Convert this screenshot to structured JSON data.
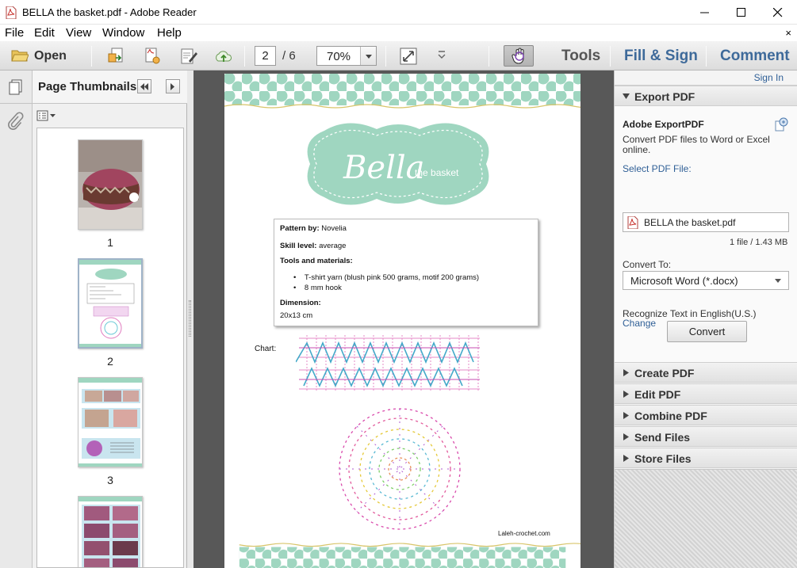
{
  "window": {
    "title": "BELLA the basket.pdf - Adobe Reader",
    "minimize_icon": "minimize-icon",
    "maximize_icon": "maximize-icon",
    "close_icon": "close-icon"
  },
  "menu": {
    "items": [
      "File",
      "Edit",
      "View",
      "Window",
      "Help"
    ],
    "close_doc": "×"
  },
  "toolbar": {
    "open_label": "Open",
    "page_current": "2",
    "page_total": "/ 6",
    "zoom": "70%",
    "tools_label": "Tools",
    "fill_sign_label": "Fill & Sign",
    "comment_label": "Comment"
  },
  "thumbnails": {
    "title": "Page Thumbnails",
    "pages": [
      "1",
      "2",
      "3"
    ]
  },
  "document": {
    "title_script": "Bella",
    "title_sub": "the basket",
    "pattern_by_label": "Pattern by:",
    "pattern_by_value": "Novelia",
    "skill_label": "Skill level:",
    "skill_value": "average",
    "tools_label": "Tools and materials:",
    "materials": [
      "T-shirt yarn (blush pink 500 grams, motif 200 grams)",
      "8 mm hook"
    ],
    "dimension_label": "Dimension:",
    "dimension_value": "20x13 cm",
    "chart_label": "Chart:",
    "site": "Laleh-crochet.com"
  },
  "right_pane": {
    "sign_in": "Sign In",
    "export_header": "Export PDF",
    "export_title": "Adobe ExportPDF",
    "export_desc_1": "Convert PDF files to Word or Excel",
    "export_desc_2": "online.",
    "select_file_label": "Select PDF File:",
    "file_name": "BELLA the basket.pdf",
    "file_info": "1 file / 1.43 MB",
    "convert_to_label": "Convert To:",
    "convert_to_value": "Microsoft Word (*.docx)",
    "recognize_text": "Recognize Text in English(U.S.)",
    "change_link": "Change",
    "convert_button": "Convert",
    "sections": [
      "Create PDF",
      "Edit PDF",
      "Combine PDF",
      "Send Files",
      "Store Files"
    ]
  },
  "colors": {
    "accent_blue": "#3e6a9a",
    "mint": "#8fd1b8",
    "link_blue": "#2f5f96"
  }
}
